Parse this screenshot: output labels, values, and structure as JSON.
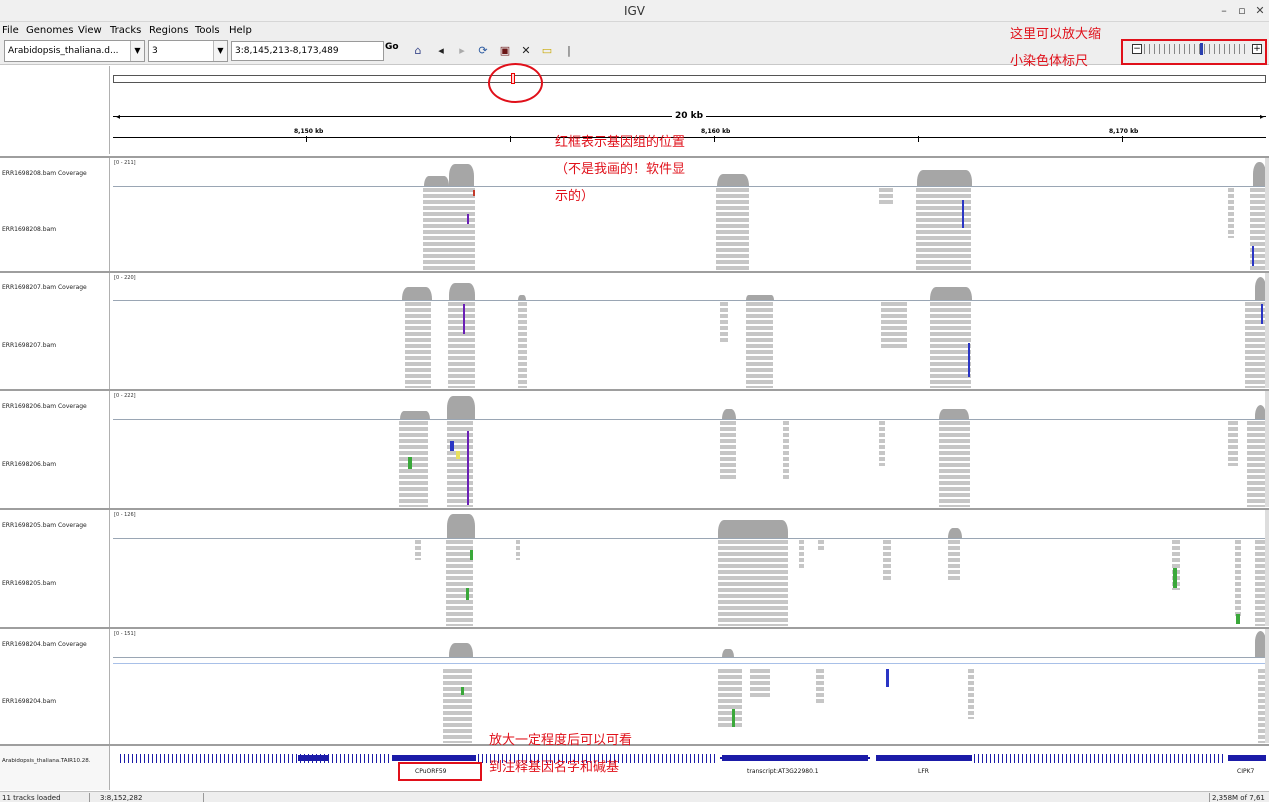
{
  "window": {
    "title": "IGV",
    "minimize": "–",
    "maximize": "▫",
    "close": "✕"
  },
  "menu": [
    "File",
    "Genomes",
    "View",
    "Tracks",
    "Regions",
    "Tools",
    "Help"
  ],
  "toolbar": {
    "genome": "Arabidopsis_thaliana.d...",
    "chromosome": "3",
    "locus": "3:8,145,213-8,173,489",
    "go": "Go",
    "zoom_minus": "−",
    "zoom_plus": "+",
    "icons": [
      "home-icon",
      "back-icon",
      "forward-icon",
      "refresh-icon",
      "region-icon",
      "resize-icon",
      "popup-text-icon"
    ]
  },
  "ruler": {
    "span": "20 kb",
    "ticks": [
      "8,150 kb",
      "8,160 kb",
      "8,170 kb"
    ]
  },
  "tracks": [
    {
      "coverage": "ERR1698208.bam Coverage",
      "reads": "ERR1698208.bam",
      "range": "[0 - 211]"
    },
    {
      "coverage": "ERR1698207.bam Coverage",
      "reads": "ERR1698207.bam",
      "range": "[0 - 220]"
    },
    {
      "coverage": "ERR1698206.bam Coverage",
      "reads": "ERR1698206.bam",
      "range": "[0 - 222]"
    },
    {
      "coverage": "ERR1698205.bam Coverage",
      "reads": "ERR1698205.bam",
      "range": "[0 - 126]"
    },
    {
      "coverage": "ERR1698204.bam Coverage",
      "reads": "ERR1698204.bam",
      "range": "[0 - 151]"
    }
  ],
  "gene_track": {
    "name": "Arabidopsis_thaliana.TAIR10.28.",
    "genes": [
      "CPuORF59",
      "transcript:AT3G22980.1",
      "LFR",
      "CIPK7"
    ]
  },
  "annotations": {
    "zoom_note_1": "这里可以放大缩",
    "zoom_note_2": "小染色体标尺",
    "ideogram_note_1": "红框表示基因组的位置",
    "ideogram_note_2": "（不是我画的！软件显",
    "ideogram_note_3": "示的）",
    "gene_note_1": "放大一定程度后可以可看",
    "gene_note_2": "到注释基因名字和碱基"
  },
  "status": {
    "loaded": "11 tracks loaded",
    "position": "3:8,152,282",
    "memory": "2,358M of 7,61"
  },
  "colors": {
    "annotation_red": "#e0101a",
    "coverage_gray": "#a6a6a6",
    "gene_blue": "#1b1ba8"
  }
}
